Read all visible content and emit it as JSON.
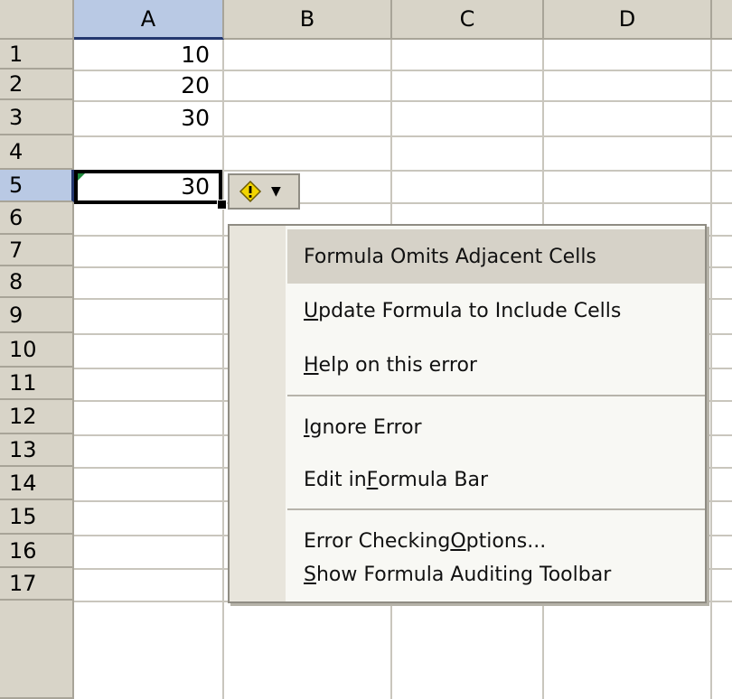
{
  "columns": [
    "A",
    "B",
    "C",
    "D"
  ],
  "rows": [
    "1",
    "2",
    "3",
    "4",
    "5",
    "6",
    "7",
    "8",
    "9",
    "10",
    "11",
    "12",
    "13",
    "14",
    "15",
    "16",
    "17"
  ],
  "cells": {
    "A1": "10",
    "A2": "20",
    "A3": "30",
    "A5": "30"
  },
  "selected_cell": "A5",
  "smart_tag": {
    "icon": "warning-diamond-icon",
    "dropdown_icon": "small-down-arrow-icon"
  },
  "menu": {
    "items": [
      {
        "pre": "Formula Omits Adjacent Cells",
        "ul": "",
        "post": "",
        "highlighted": true
      },
      {
        "pre": "",
        "ul": "U",
        "post": "pdate Formula to Include Cells"
      },
      {
        "pre": "",
        "ul": "H",
        "post": "elp on this error"
      },
      {
        "pre": "",
        "ul": "I",
        "post": "gnore Error"
      },
      {
        "pre": "Edit in ",
        "ul": "F",
        "post": "ormula Bar"
      },
      {
        "pre": "Error Checking ",
        "ul": "O",
        "post": "ptions..."
      },
      {
        "pre": "",
        "ul": "S",
        "post": "how Formula Auditing Toolbar"
      }
    ]
  },
  "colors": {
    "header_bg": "#d8d4c8",
    "selected_header_bg": "#b9c9e4",
    "warning": "#f2d400"
  }
}
